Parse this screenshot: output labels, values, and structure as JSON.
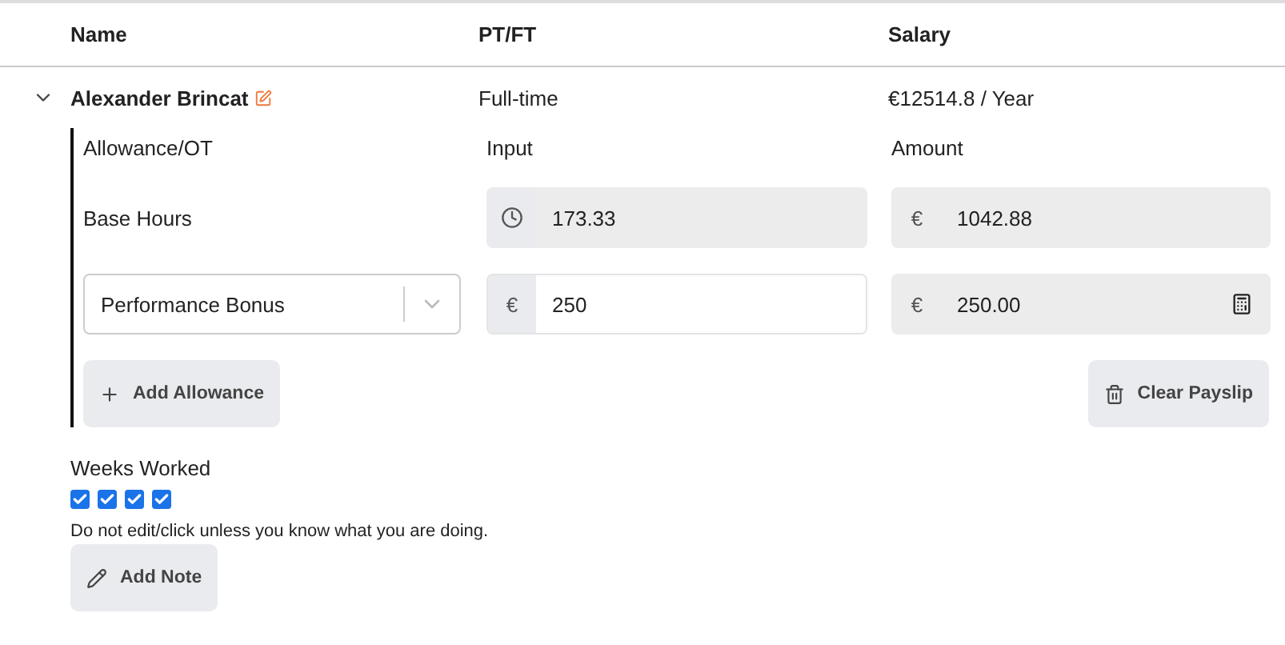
{
  "columns": [
    "Name",
    "PT/FT",
    "Salary"
  ],
  "employee": {
    "name": "Alexander Brincat",
    "expanded": true,
    "type": "Full-time",
    "salary": "€12514.8 / Year"
  },
  "detail_columns": [
    "Allowance/OT",
    "Input",
    "Amount"
  ],
  "rows": [
    {
      "kind": "fixed",
      "label": "Base Hours",
      "input": "173.33",
      "currency": "€",
      "amount": "1042.88"
    },
    {
      "kind": "select",
      "label": "Performance Bonus",
      "addon": "€",
      "input": "250",
      "currency": "€",
      "amount": "250.00",
      "calculator": true
    }
  ],
  "add_allowance": "Add Allowance",
  "clear_payslip": "Clear Payslip",
  "weeks_label": "Weeks Worked",
  "weeks": [
    {
      "checked": true
    },
    {
      "checked": true
    },
    {
      "checked": true
    },
    {
      "checked": true
    }
  ],
  "warning": "Do not edit/click unless you know what you are doing.",
  "add_note": "Add Note"
}
